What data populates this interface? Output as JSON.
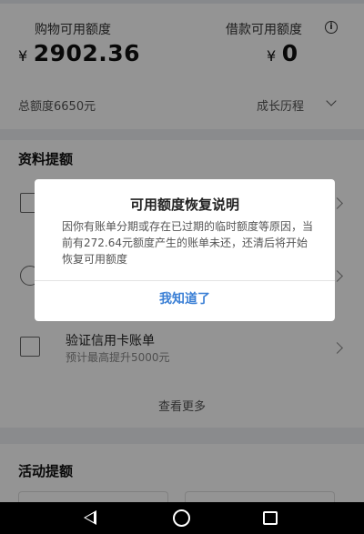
{
  "header": {
    "shopping_label": "购物可用额度",
    "shopping_currency": "¥",
    "shopping_amount": "2902.36",
    "loan_label": "借款可用额度",
    "loan_info_glyph": "i",
    "loan_currency": "¥",
    "loan_amount": "0",
    "total_limit": "总额度6650元",
    "growth_link": "成长历程"
  },
  "data_section": {
    "title": "资料提额",
    "items": [
      {
        "title": "",
        "subtitle": "",
        "icon": "house-icon"
      },
      {
        "title": "",
        "subtitle": "",
        "icon": "card-icon"
      },
      {
        "title": "验证信用卡账单",
        "subtitle": "预计最高提升5000元",
        "icon": "receipt-icon"
      }
    ],
    "more_label": "查看更多"
  },
  "activity_section": {
    "title": "活动提额"
  },
  "dialog": {
    "title": "可用额度恢复说明",
    "body": "因你有账单分期或存在已过期的临时额度等原因，当前有272.64元额度产生的账单未还，还清后将开始恢复可用额度",
    "confirm_label": "我知道了"
  },
  "colors": {
    "accent": "#3a7fd5",
    "overlay": "rgba(0,0,0,0.42)"
  }
}
